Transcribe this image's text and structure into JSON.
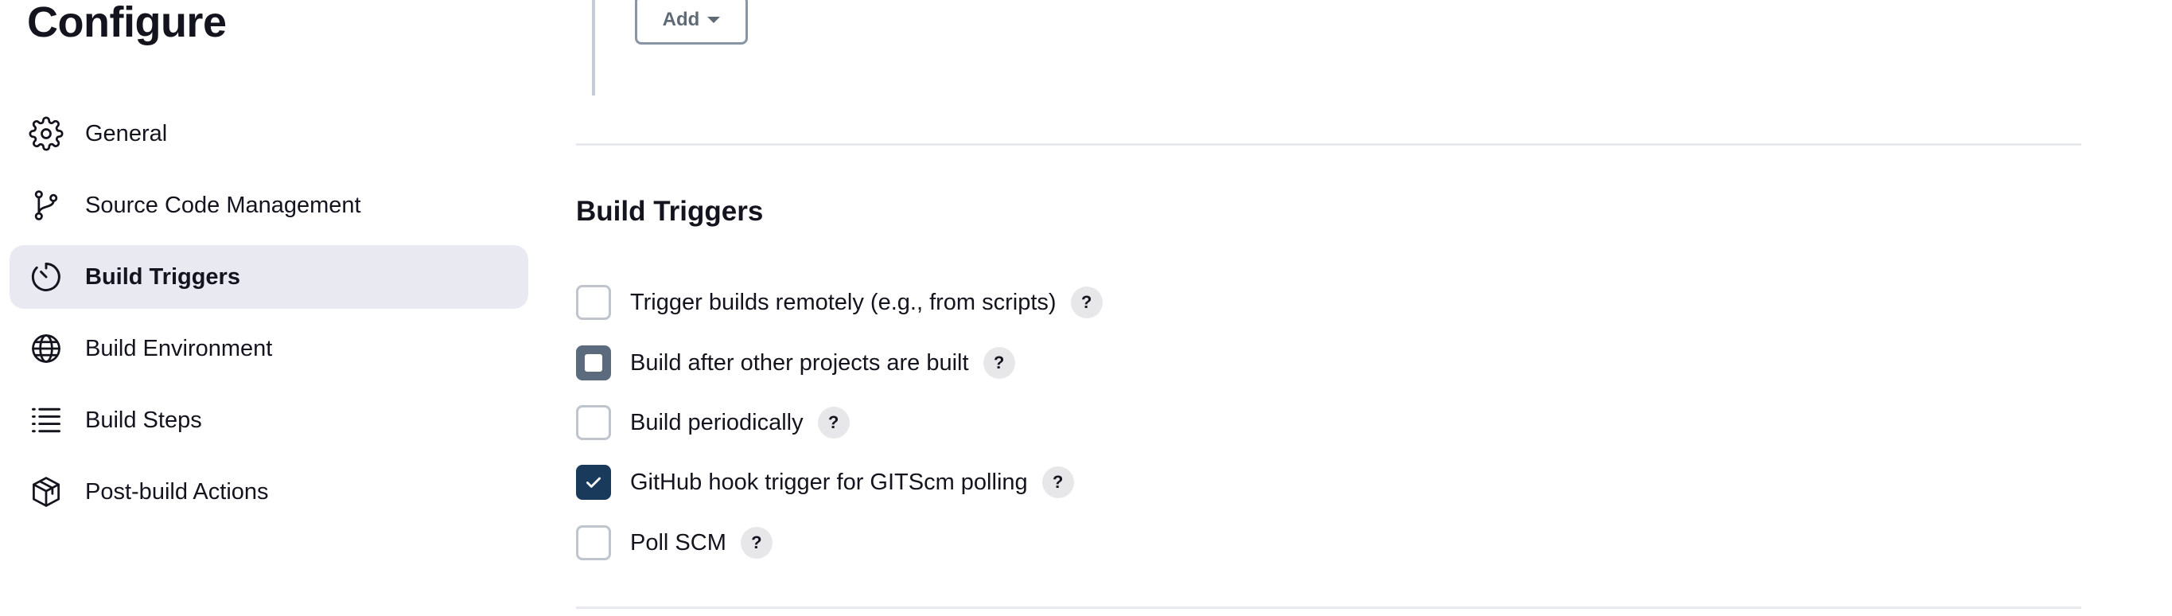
{
  "page": {
    "title": "Configure"
  },
  "sidebar": {
    "items": [
      {
        "label": "General",
        "icon": "gear-icon"
      },
      {
        "label": "Source Code Management",
        "icon": "git-branch-icon"
      },
      {
        "label": "Build Triggers",
        "icon": "timer-icon",
        "active": true
      },
      {
        "label": "Build Environment",
        "icon": "globe-icon"
      },
      {
        "label": "Build Steps",
        "icon": "list-icon"
      },
      {
        "label": "Post-build Actions",
        "icon": "package-icon"
      }
    ]
  },
  "main": {
    "add_button_label": "Add",
    "section_title": "Build Triggers",
    "help_label": "?",
    "triggers": [
      {
        "label": "Trigger builds remotely (e.g., from scripts)",
        "checked": false
      },
      {
        "label": "Build after other projects are built",
        "checked": false,
        "focused": true
      },
      {
        "label": "Build periodically",
        "checked": false
      },
      {
        "label": "GitHub hook trigger for GITScm polling",
        "checked": true
      },
      {
        "label": "Poll SCM",
        "checked": false
      }
    ]
  },
  "colors": {
    "accent": "#1a3a5c",
    "active_bg": "#e9e9f1",
    "divider": "#e8e9ee",
    "checkbox_border": "#bfc5cc"
  }
}
